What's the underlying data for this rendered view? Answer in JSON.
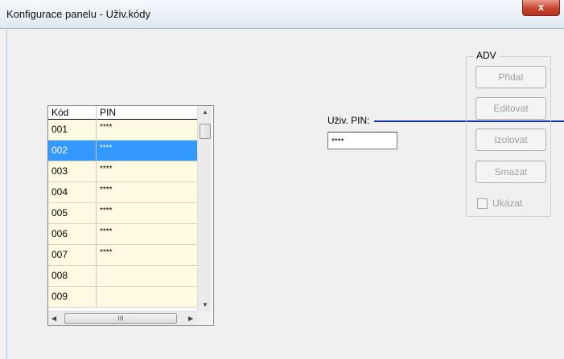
{
  "window": {
    "title": "Konfigurace panelu - Uživ.kódy",
    "close_glyph": "x"
  },
  "grid": {
    "columns": [
      "Kód",
      "PIN"
    ],
    "rows": [
      {
        "kod": "001",
        "pin": "****",
        "selected": false
      },
      {
        "kod": "002",
        "pin": "****",
        "selected": true
      },
      {
        "kod": "003",
        "pin": "****",
        "selected": false
      },
      {
        "kod": "004",
        "pin": "****",
        "selected": false
      },
      {
        "kod": "005",
        "pin": "****",
        "selected": false
      },
      {
        "kod": "006",
        "pin": "****",
        "selected": false
      },
      {
        "kod": "007",
        "pin": "****",
        "selected": false
      },
      {
        "kod": "008",
        "pin": "",
        "selected": false
      },
      {
        "kod": "009",
        "pin": "",
        "selected": false
      }
    ],
    "hscroll_grip": "III"
  },
  "pin_field": {
    "label": "Uživ. PIN:",
    "value": "****"
  },
  "adv": {
    "legend": "ADV",
    "buttons": [
      {
        "label": "Přidat",
        "enabled": false
      },
      {
        "label": "Editovat",
        "enabled": false
      },
      {
        "label": "Izolovat",
        "enabled": false
      },
      {
        "label": "Smazat",
        "enabled": false
      }
    ],
    "checkbox_label": "Ukázat",
    "checkbox_checked": false
  },
  "colors": {
    "row_bg": "#fefbe2",
    "selected_bg": "#3399ff",
    "line": "#1a2fb0"
  }
}
